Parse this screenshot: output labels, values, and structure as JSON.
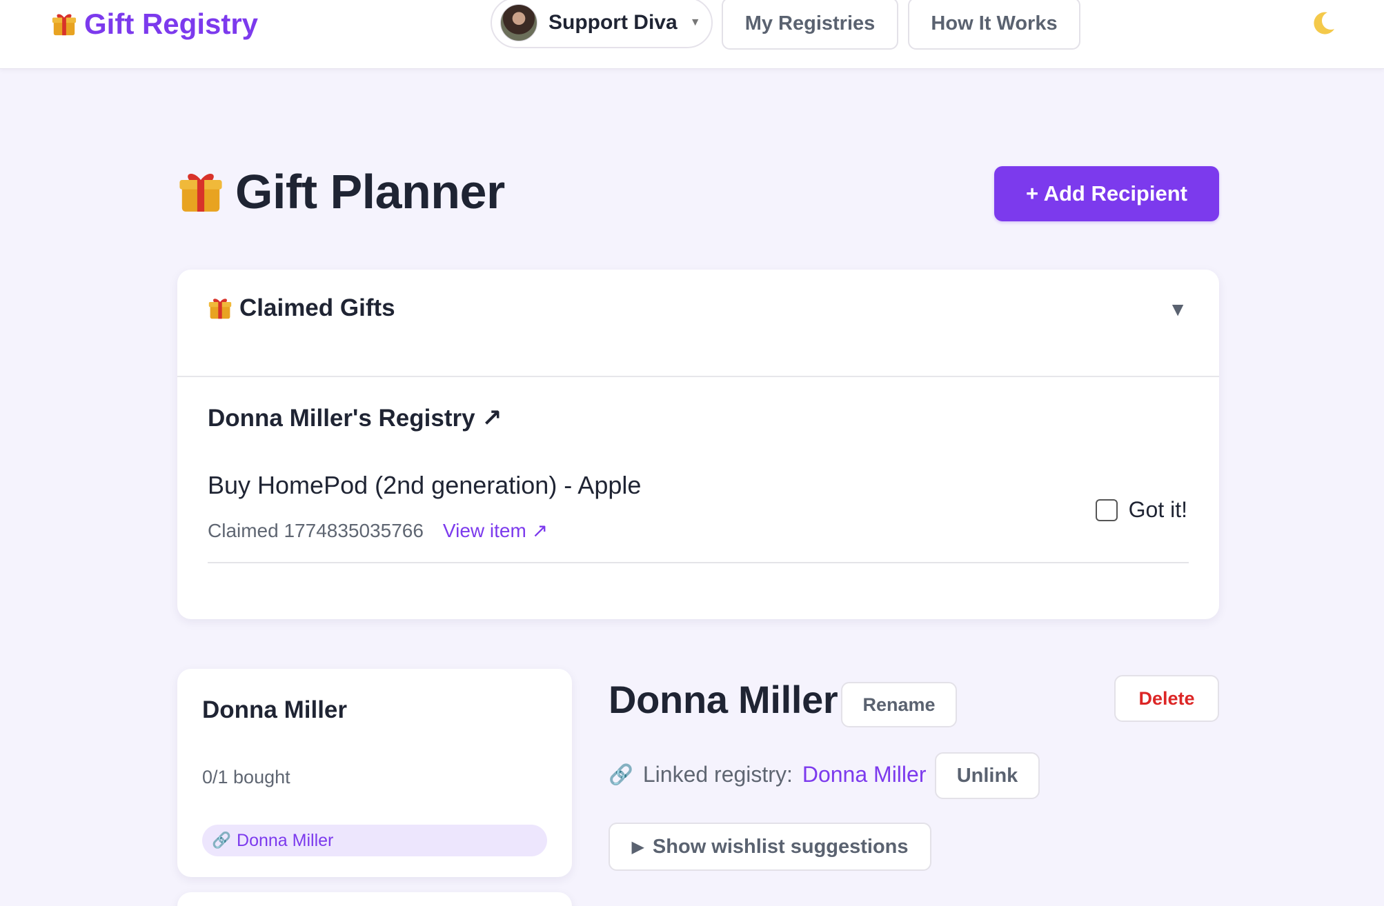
{
  "nav": {
    "brand": "Gift Registry",
    "user_name": "Support Diva",
    "my_registries": "My Registries",
    "how_it_works": "How It Works"
  },
  "header": {
    "title": "Gift Planner",
    "add_button": "+ Add Recipient"
  },
  "claimed": {
    "title": "Claimed Gifts",
    "toggle_symbol": "▼",
    "registry_title": "Donna Miller's Registry",
    "registry_arrow": "↗",
    "item": {
      "name": "Buy HomePod (2nd generation) - Apple",
      "claimed_text": "Claimed 1774835035766",
      "view_link": "View item",
      "view_arrow": "↗",
      "got_it_label": "Got it!",
      "got_it_checked": false
    }
  },
  "recipients": [
    {
      "name": "Donna Miller",
      "progress": "0/1 bought",
      "linked_name": "Donna Miller"
    }
  ],
  "detail": {
    "name": "Donna Miller",
    "rename": "Rename",
    "delete": "Delete",
    "linked_label": "Linked registry:",
    "linked_value": "Donna Miller",
    "unlink": "Unlink",
    "wishlist_toggle": "Show wishlist suggestions",
    "wishlist_symbol": "▶"
  },
  "icons": {
    "brand": "gift-icon",
    "theme_toggle": "moon-icon",
    "link": "link-icon",
    "toggle": "chevron-down-icon"
  },
  "colors": {
    "accent": "#7c3aed",
    "danger": "#dc2626",
    "background": "#f5f3fd",
    "badge_bg": "#ede6fd"
  }
}
